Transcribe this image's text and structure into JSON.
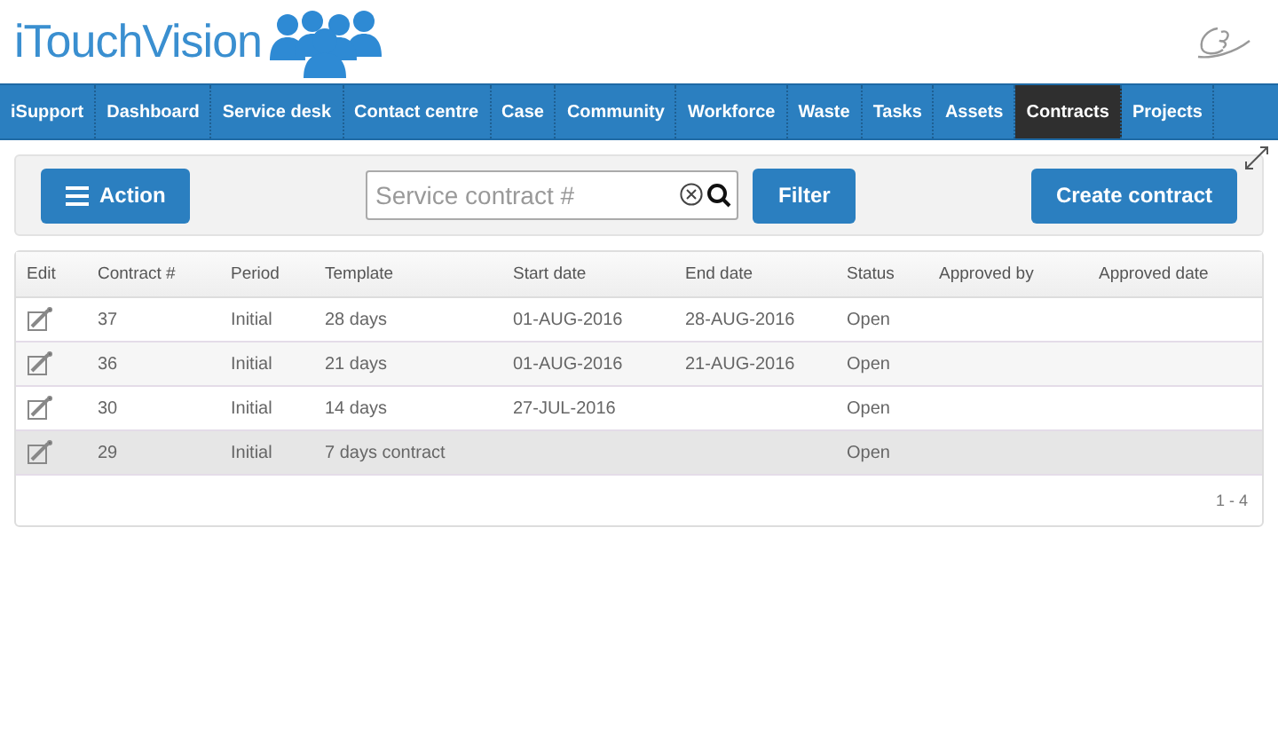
{
  "header": {
    "logo_text": "iTouchVision"
  },
  "nav": [
    {
      "label": "iSupport",
      "selected": false
    },
    {
      "label": "Dashboard",
      "selected": false
    },
    {
      "label": "Service desk",
      "selected": false
    },
    {
      "label": "Contact centre",
      "selected": false
    },
    {
      "label": "Case",
      "selected": false
    },
    {
      "label": "Community",
      "selected": false
    },
    {
      "label": "Workforce",
      "selected": false
    },
    {
      "label": "Waste",
      "selected": false
    },
    {
      "label": "Tasks",
      "selected": false
    },
    {
      "label": "Assets",
      "selected": false
    },
    {
      "label": "Contracts",
      "selected": true
    },
    {
      "label": "Projects",
      "selected": false
    }
  ],
  "toolbar": {
    "action_button": "Action",
    "search": {
      "placeholder": "Service contract #"
    },
    "filter_button": "Filter",
    "create_button": "Create contract"
  },
  "table": {
    "columns": [
      "Edit",
      "Contract #",
      "Period",
      "Template",
      "Start date",
      "End date",
      "Status",
      "Approved by",
      "Approved date"
    ],
    "rows": [
      {
        "contract": "37",
        "period": "Initial",
        "template": "28 days",
        "start": "01-AUG-2016",
        "end": "28-AUG-2016",
        "status": "Open",
        "highlighted": false
      },
      {
        "contract": "36",
        "period": "Initial",
        "template": "21 days",
        "start": "01-AUG-2016",
        "end": "21-AUG-2016",
        "status": "Open",
        "highlighted": false
      },
      {
        "contract": "30",
        "period": "Initial",
        "template": "14 days",
        "start": "27-JUL-2016",
        "end": "",
        "status": "Open",
        "highlighted": false
      },
      {
        "contract": "29",
        "period": "Initial",
        "template": "7 days contract",
        "start": "",
        "end": "",
        "status": "Open",
        "highlighted": true
      }
    ],
    "pager": "1 - 4"
  }
}
